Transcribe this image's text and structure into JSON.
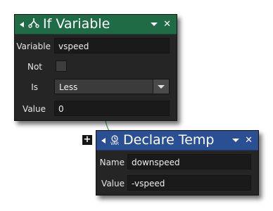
{
  "if_variable": {
    "title": "If Variable",
    "header_color": "#1f6b46",
    "fields": {
      "variable_label": "Variable",
      "variable_value": "vspeed",
      "not_label": "Not",
      "is_label": "Is",
      "is_value": "Less",
      "value_label": "Value",
      "value_value": "0"
    }
  },
  "declare_temp": {
    "title": "Declare Temp",
    "header_color": "#2b4f93",
    "icon_text": "VAR",
    "fields": {
      "name_label": "Name",
      "name_value": "downspeed",
      "value_label": "Value",
      "value_value": "-vspeed"
    }
  },
  "add_button_label": "+"
}
